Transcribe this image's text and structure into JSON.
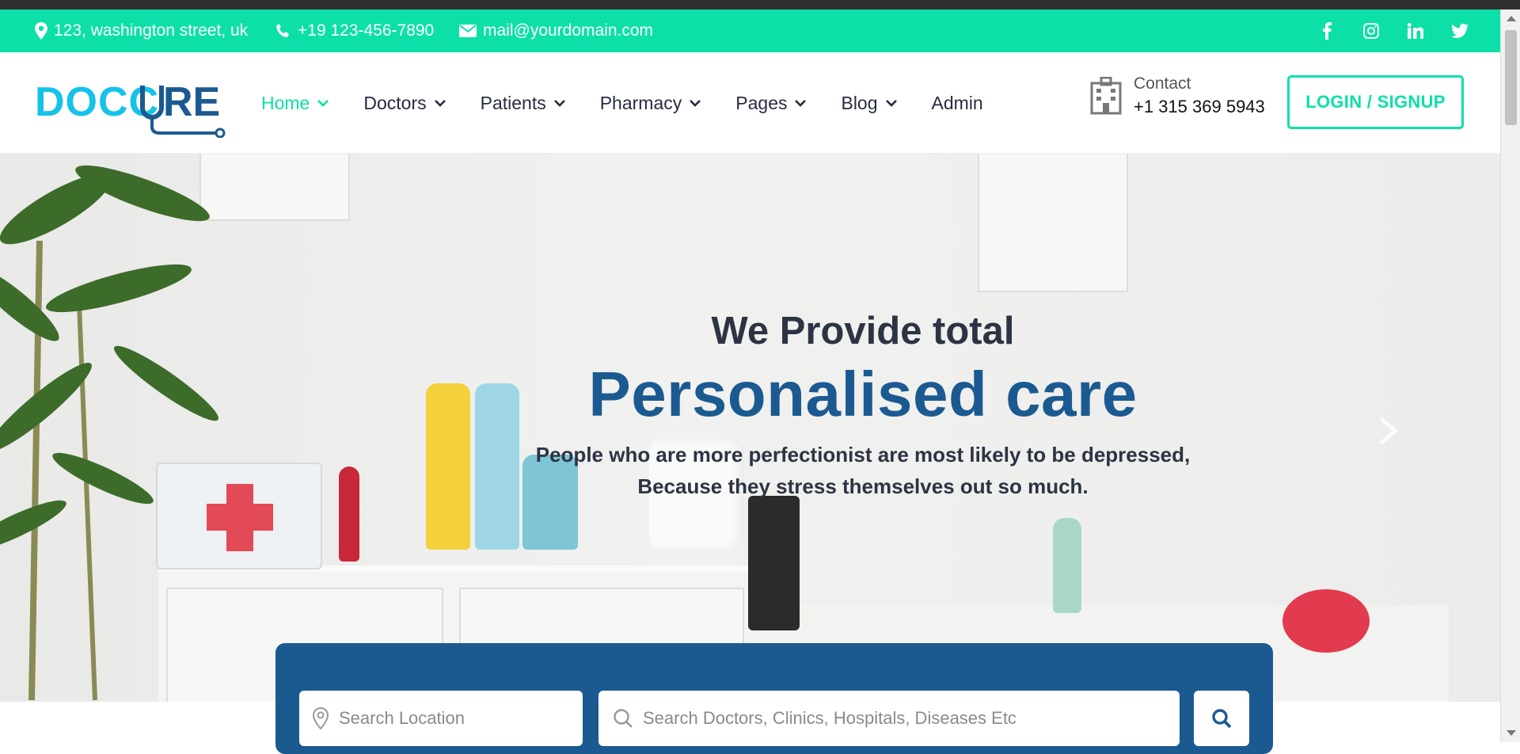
{
  "topbar": {
    "address": "123, washington street, uk",
    "phone": "+19 123-456-7890",
    "email": "mail@yourdomain.com",
    "socials": [
      "facebook-icon",
      "instagram-icon",
      "linkedin-icon",
      "twitter-icon"
    ]
  },
  "header": {
    "logo": "DOCCURE",
    "nav": [
      {
        "label": "Home",
        "dropdown": true,
        "active": true
      },
      {
        "label": "Doctors",
        "dropdown": true
      },
      {
        "label": "Patients",
        "dropdown": true
      },
      {
        "label": "Pharmacy",
        "dropdown": true
      },
      {
        "label": "Pages",
        "dropdown": true
      },
      {
        "label": "Blog",
        "dropdown": true
      },
      {
        "label": "Admin",
        "dropdown": false
      }
    ],
    "contact_label": "Contact",
    "contact_phone": "+1 315 369 5943",
    "login_label": "LOGIN / SIGNUP"
  },
  "hero": {
    "line1": "We Provide total",
    "line2": "Personalised care",
    "line3a": "People who are more perfectionist are most likely to be depressed,",
    "line3b": "Because they stress themselves out so much."
  },
  "search": {
    "location_placeholder": "Search Location",
    "query_placeholder": "Search Doctors, Clinics, Hospitals, Diseases Etc"
  },
  "colors": {
    "accent": "#0ce0a8",
    "brand_blue": "#1b5a91",
    "logo_cyan": "#15c2e8"
  }
}
